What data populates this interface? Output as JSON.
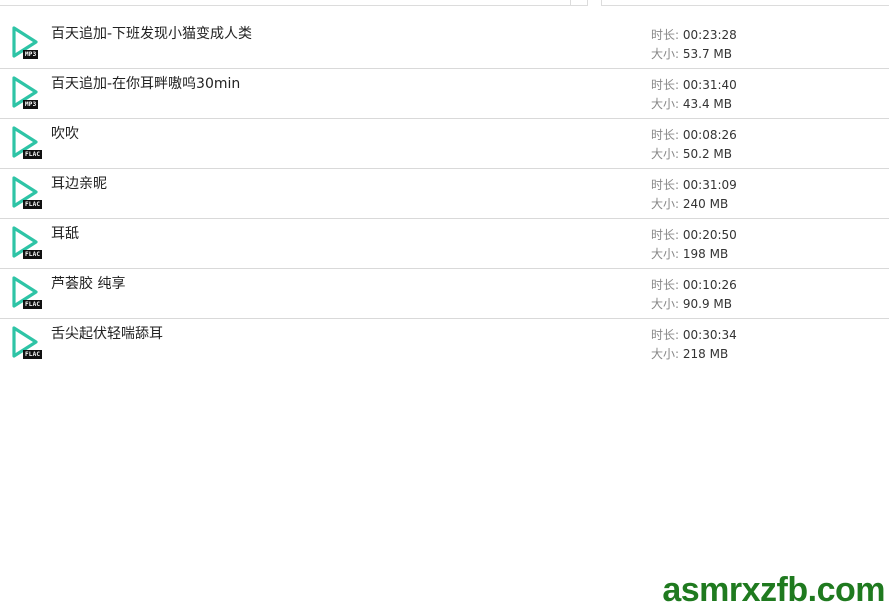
{
  "files": [
    {
      "title": "百天追加-下班发现小猫变成人类",
      "format": "MP3",
      "duration_label": "时长:",
      "duration": "00:23:28",
      "size_label": "大小:",
      "size": "53.7 MB"
    },
    {
      "title": "百天追加-在你耳畔嗷呜30min",
      "format": "MP3",
      "duration_label": "时长:",
      "duration": "00:31:40",
      "size_label": "大小:",
      "size": "43.4 MB"
    },
    {
      "title": "吹吹",
      "format": "FLAC",
      "duration_label": "时长:",
      "duration": "00:08:26",
      "size_label": "大小:",
      "size": "50.2 MB"
    },
    {
      "title": "耳边亲昵",
      "format": "FLAC",
      "duration_label": "时长:",
      "duration": "00:31:09",
      "size_label": "大小:",
      "size": "240 MB"
    },
    {
      "title": "耳舐",
      "format": "FLAC",
      "duration_label": "时长:",
      "duration": "00:20:50",
      "size_label": "大小:",
      "size": "198 MB"
    },
    {
      "title": "芦荟胶 纯享",
      "format": "FLAC",
      "duration_label": "时长:",
      "duration": "00:10:26",
      "size_label": "大小:",
      "size": "90.9 MB"
    },
    {
      "title": "舌尖起伏轻喘舔耳",
      "format": "FLAC",
      "duration_label": "时长:",
      "duration": "00:30:34",
      "size_label": "大小:",
      "size": "218 MB"
    }
  ],
  "icon": "play-file-icon",
  "accent_color": "#2ec4a6",
  "watermark": "asmrxzfb.com"
}
